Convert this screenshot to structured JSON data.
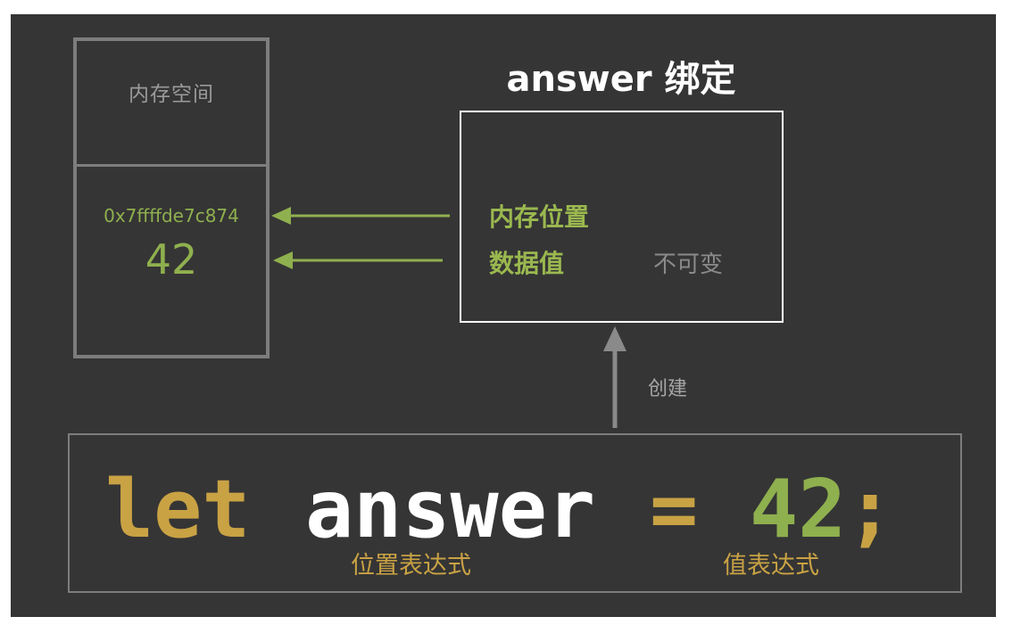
{
  "memory": {
    "title": "内存空间",
    "address": "0x7ffffde7c874",
    "value": "42"
  },
  "binding": {
    "title": "answer 绑定",
    "location_label": "内存位置",
    "data_label": "数据值",
    "immutable_label": "不可变"
  },
  "create_label": "创建",
  "code": {
    "keyword": "let",
    "identifier": "answer",
    "operator": "=",
    "value": "42",
    "terminator": ";"
  },
  "annotations": {
    "location_expression": "位置表达式",
    "value_expression": "值表达式"
  },
  "colors": {
    "background": "#353535",
    "green": "#8fb04e",
    "yellow": "#c9a244",
    "gray": "#7d7d7d",
    "white": "#ffffff"
  }
}
